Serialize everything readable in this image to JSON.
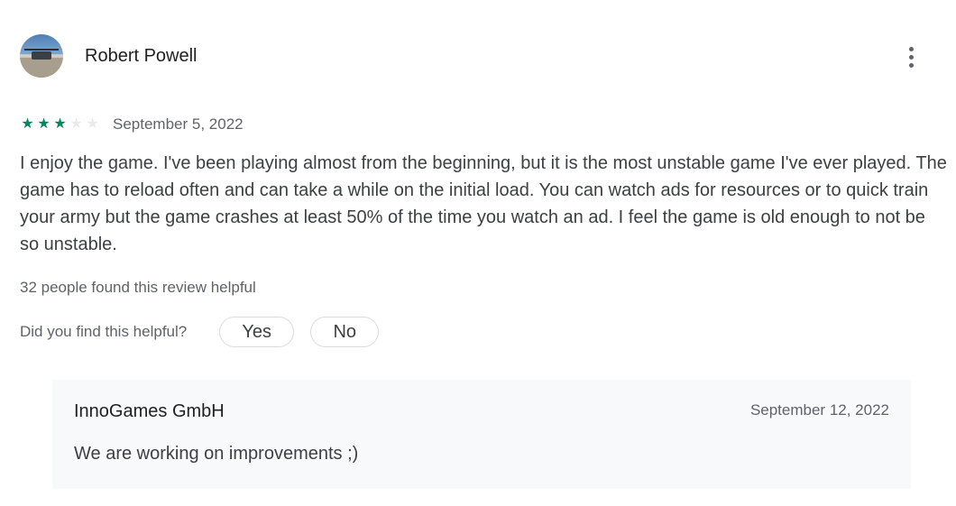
{
  "review": {
    "author": "Robert Powell",
    "rating": 3,
    "rating_max": 5,
    "date": "September 5, 2022",
    "text": "I enjoy the game. I've been playing almost from the beginning, but it is the most unstable game I've ever played. The game has to reload often and can take a while on the initial load. You can watch ads for resources or to quick train your army but the game crashes at least 50% of the time you watch an ad. I feel the game is old enough to not be so unstable.",
    "helpful_count_text": "32 people found this review helpful",
    "helpful_question": "Did you find this helpful?",
    "yes_label": "Yes",
    "no_label": "No",
    "icons": {
      "avatar": "avatar-photo",
      "more": "more-vert-icon",
      "star": "star-icon"
    },
    "colors": {
      "star_filled": "#01875f",
      "star_empty": "#e8eaed"
    }
  },
  "reply": {
    "author": "InnoGames GmbH",
    "date": "September 12, 2022",
    "text": "We are working on improvements ;)"
  }
}
